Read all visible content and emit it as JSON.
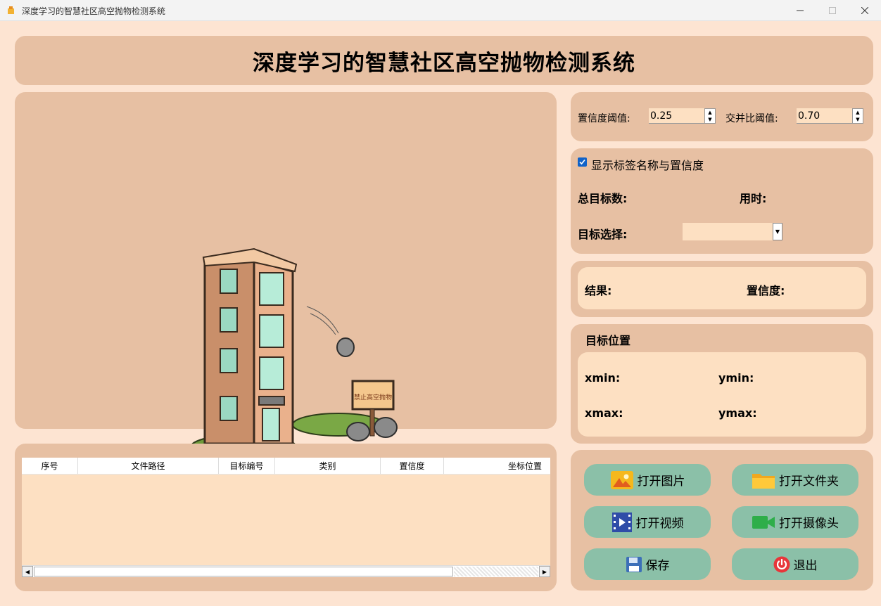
{
  "window": {
    "title": "深度学习的智慧社区高空抛物检测系统"
  },
  "header": {
    "title": "深度学习的智慧社区高空抛物检测系统"
  },
  "image_view": {
    "sign_text": "禁止高空抛物"
  },
  "table": {
    "columns": [
      "序号",
      "文件路径",
      "目标编号",
      "类别",
      "置信度",
      "坐标位置"
    ],
    "rows": []
  },
  "thresholds": {
    "conf_label": "置信度阈值:",
    "conf_value": "0.25",
    "iou_label": "交并比阈值:",
    "iou_value": "0.70"
  },
  "options": {
    "show_label": "显示标签名称与置信度",
    "show_checked": true,
    "total_label": "总目标数:",
    "time_label": "用时:",
    "select_label": "目标选择:",
    "select_value": ""
  },
  "result": {
    "result_label": "结果:",
    "conf_label": "置信度:"
  },
  "position": {
    "title": "目标位置",
    "xmin": "xmin:",
    "ymin": "ymin:",
    "xmax": "xmax:",
    "ymax": "ymax:"
  },
  "buttons": {
    "open_image": "打开图片",
    "open_folder": "打开文件夹",
    "open_video": "打开视频",
    "open_camera": "打开摄像头",
    "save": "保存",
    "exit": "退出"
  },
  "colors": {
    "background": "#fde4d2",
    "panel": "#e7c0a3",
    "inner": "#fde0c2",
    "button": "#8bc0a8",
    "checkbox": "#1062c8"
  },
  "icons": {
    "open_image": "image-icon",
    "open_folder": "folder-icon",
    "open_video": "video-icon",
    "open_camera": "camera-icon",
    "save": "save-icon",
    "exit": "power-icon"
  }
}
